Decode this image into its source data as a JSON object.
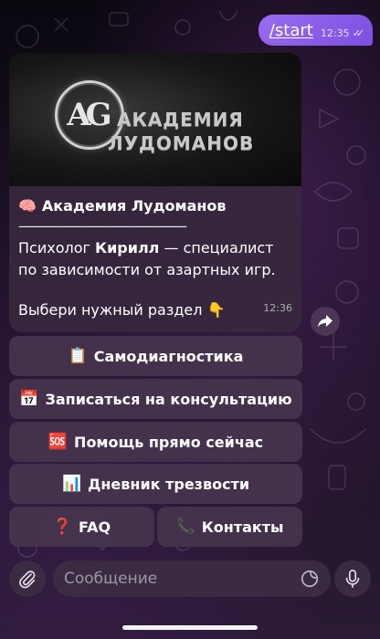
{
  "outgoing": {
    "text": "/start",
    "time": "12:35"
  },
  "incoming": {
    "banner": {
      "logo_letters": "AG",
      "title_line1": "АКАДЕМИЯ",
      "title_line2": "ЛУДОМАНОВ"
    },
    "title_emoji": "🧠",
    "title": "Академия Лудоманов",
    "rule": "——————————————",
    "line1_prefix": "Психолог ",
    "line1_bold": "Кирилл",
    "line1_suffix": " — специалист",
    "line2": "по зависимости от азартных игр.",
    "line3": "Выбери нужный раздел 👇",
    "time": "12:36"
  },
  "keyboard": {
    "self_diagnosis": {
      "emoji": "📋",
      "label": "Самодиагностика"
    },
    "consultation": {
      "emoji": "📅",
      "label": "Записаться на консультацию"
    },
    "help_now": {
      "emoji": "🆘",
      "label": "Помощь прямо сейчас"
    },
    "diary": {
      "emoji": "📊",
      "label": "Дневник трезвости"
    },
    "faq": {
      "emoji": "❓",
      "label": "FAQ"
    },
    "contacts": {
      "emoji": "📞",
      "label": "Контакты"
    }
  },
  "composer": {
    "placeholder": "Сообщение"
  },
  "colors": {
    "outgoing_bubble": "#8b5cf6",
    "incoming_bubble": "#37283e",
    "keyboard_button": "#46344e"
  },
  "icons": {
    "attach": "paperclip-icon",
    "sticker": "sticker-icon",
    "mic": "microphone-icon",
    "share": "forward-icon",
    "read": "double-check-icon"
  }
}
